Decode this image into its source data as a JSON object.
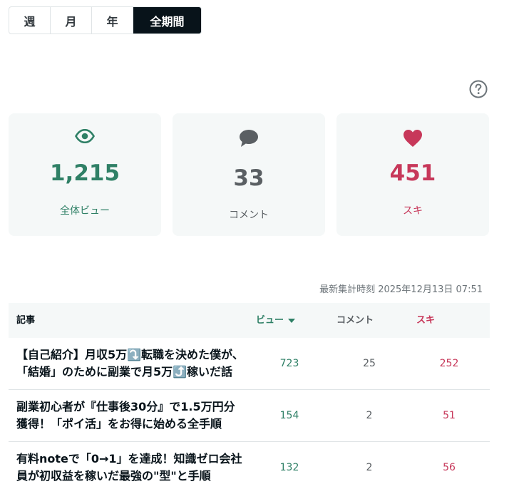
{
  "tabs": [
    {
      "label": "週"
    },
    {
      "label": "月"
    },
    {
      "label": "年"
    },
    {
      "label": "全期間",
      "active": true
    }
  ],
  "stats": {
    "views": {
      "value": "1,215",
      "label": "全体ビュー",
      "icon": "eye-icon"
    },
    "comments": {
      "value": "33",
      "label": "コメント",
      "icon": "comment-bubble-icon"
    },
    "likes": {
      "value": "451",
      "label": "スキ",
      "icon": "heart-icon"
    }
  },
  "updated_at": "最新集計時刻 2025年12月13日 07:51",
  "table": {
    "headers": {
      "article": "記事",
      "views": "ビュー",
      "comments": "コメント",
      "likes": "スキ"
    },
    "rows": [
      {
        "title": "【自己紹介】月収5万⤵️転職を決めた僕が、「結婚」のために副業で月5万⤴️稼いだ話",
        "views": "723",
        "comments": "25",
        "likes": "252"
      },
      {
        "title": "副業初心者が『仕事後30分』で1.5万円分獲得！「ポイ活」をお得に始める全手順",
        "views": "154",
        "comments": "2",
        "likes": "51"
      },
      {
        "title": "有料noteで「0→1」を達成！知識ゼロ会社員が初収益を稼いだ最強の\"型\"と手順",
        "views": "132",
        "comments": "2",
        "likes": "56"
      }
    ]
  },
  "colors": {
    "views": "#2f8066",
    "comments": "#5a5f63",
    "likes": "#c7385a",
    "active_tab": "#08131a"
  }
}
